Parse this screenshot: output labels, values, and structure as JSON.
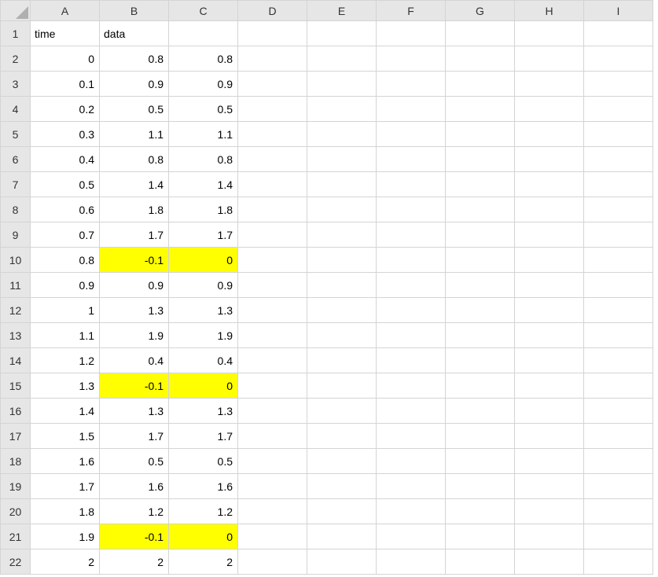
{
  "columns": [
    "A",
    "B",
    "C",
    "D",
    "E",
    "F",
    "G",
    "H",
    "I"
  ],
  "row_numbers": [
    1,
    2,
    3,
    4,
    5,
    6,
    7,
    8,
    9,
    10,
    11,
    12,
    13,
    14,
    15,
    16,
    17,
    18,
    19,
    20,
    21,
    22
  ],
  "header_row": {
    "A": "time",
    "B": "data"
  },
  "rows": [
    {
      "A": "0",
      "B": "0.8",
      "C": "0.8",
      "hl": false
    },
    {
      "A": "0.1",
      "B": "0.9",
      "C": "0.9",
      "hl": false
    },
    {
      "A": "0.2",
      "B": "0.5",
      "C": "0.5",
      "hl": false
    },
    {
      "A": "0.3",
      "B": "1.1",
      "C": "1.1",
      "hl": false
    },
    {
      "A": "0.4",
      "B": "0.8",
      "C": "0.8",
      "hl": false
    },
    {
      "A": "0.5",
      "B": "1.4",
      "C": "1.4",
      "hl": false
    },
    {
      "A": "0.6",
      "B": "1.8",
      "C": "1.8",
      "hl": false
    },
    {
      "A": "0.7",
      "B": "1.7",
      "C": "1.7",
      "hl": false
    },
    {
      "A": "0.8",
      "B": "-0.1",
      "C": "0",
      "hl": true
    },
    {
      "A": "0.9",
      "B": "0.9",
      "C": "0.9",
      "hl": false
    },
    {
      "A": "1",
      "B": "1.3",
      "C": "1.3",
      "hl": false
    },
    {
      "A": "1.1",
      "B": "1.9",
      "C": "1.9",
      "hl": false
    },
    {
      "A": "1.2",
      "B": "0.4",
      "C": "0.4",
      "hl": false
    },
    {
      "A": "1.3",
      "B": "-0.1",
      "C": "0",
      "hl": true
    },
    {
      "A": "1.4",
      "B": "1.3",
      "C": "1.3",
      "hl": false
    },
    {
      "A": "1.5",
      "B": "1.7",
      "C": "1.7",
      "hl": false
    },
    {
      "A": "1.6",
      "B": "0.5",
      "C": "0.5",
      "hl": false
    },
    {
      "A": "1.7",
      "B": "1.6",
      "C": "1.6",
      "hl": false
    },
    {
      "A": "1.8",
      "B": "1.2",
      "C": "1.2",
      "hl": false
    },
    {
      "A": "1.9",
      "B": "-0.1",
      "C": "0",
      "hl": true
    },
    {
      "A": "2",
      "B": "2",
      "C": "2",
      "hl": false
    }
  ]
}
